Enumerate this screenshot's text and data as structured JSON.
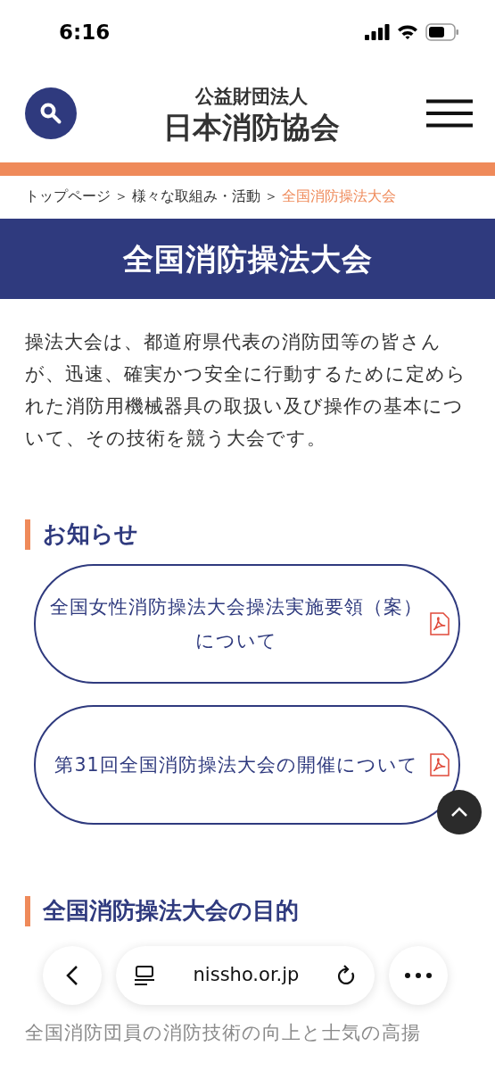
{
  "status_bar": {
    "time": "6:16"
  },
  "header": {
    "org_type": "公益財団法人",
    "org_name": "日本消防協会"
  },
  "breadcrumb": [
    {
      "label": "トップページ",
      "current": false
    },
    {
      "label": "様々な取組み・活動",
      "current": false
    },
    {
      "label": "全国消防操法大会",
      "current": true
    }
  ],
  "breadcrumb_separator": "＞",
  "page_title": "全国消防操法大会",
  "intro": "操法大会は、都道府県代表の消防団等の皆さんが、迅速、確実かつ安全に行動するために定められた消防用機械器具の取扱い及び操作の基本について、その技術を競う大会です。",
  "notices": {
    "heading": "お知らせ",
    "items": [
      {
        "label": "全国女性消防操法大会操法実施要領（案）について",
        "kind": "pdf"
      },
      {
        "label": "第31回全国消防操法大会の開催について",
        "kind": "pdf"
      }
    ]
  },
  "purpose": {
    "heading": "全国消防操法大会の目的",
    "text": "全国消防団員の消防技術の向上と士気の高揚"
  },
  "browser_bar": {
    "url": "nissho.or.jp"
  }
}
